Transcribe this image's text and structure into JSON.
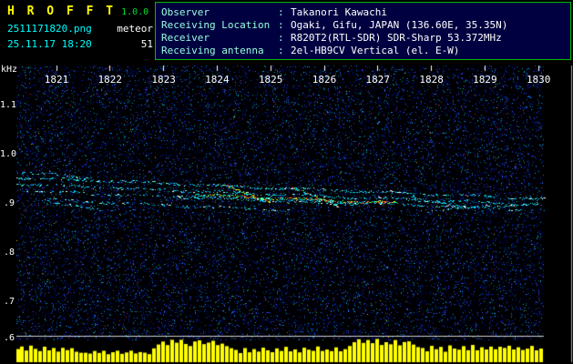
{
  "header": {
    "app_title": "H R O F F T",
    "app_version": "1.0.0",
    "filename": "2511171820.png",
    "mode": "meteor",
    "timestamp": "25.11.17 18:20",
    "count": "51"
  },
  "info": {
    "colon": ":",
    "rows": [
      {
        "label": "Observer",
        "value": "Takanori Kawachi"
      },
      {
        "label": "Receiving Location",
        "value": "Ogaki, Gifu, JAPAN (136.60E, 35.35N)"
      },
      {
        "label": "Receiver",
        "value": "R820T2(RTL-SDR) SDR-Sharp 53.372MHz"
      },
      {
        "label": "Receiving antenna",
        "value": "2el-HB9CV Vertical (el. E-W)"
      }
    ]
  },
  "colors": {
    "bg": "#000000",
    "panel-bg": "#000041",
    "panel-border": "#00bb00",
    "title-yellow": "#ffff00",
    "version-green": "#00dd33",
    "cyan": "#00ffff",
    "white": "#ffffff",
    "info-label": "#99ffdd",
    "axis-text": "#ffffff",
    "separator": "#cccccc"
  },
  "chart_data": {
    "type": "heatmap",
    "subtype": "radio-meteor-spectrogram",
    "x_axis": {
      "ticks": [
        "1821",
        "1822",
        "1823",
        "1824",
        "1825",
        "1826",
        "1827",
        "1828",
        "1829",
        "1830"
      ]
    },
    "y_axis": {
      "unit": "kHz",
      "tick_values": [
        1.1,
        1.0,
        0.9,
        0.8,
        0.7,
        0.6
      ],
      "tick_labels": [
        "1.1",
        "1.0",
        ".9",
        ".8",
        ".7",
        ".6"
      ],
      "range_khz": [
        0.62,
        1.18
      ]
    },
    "traces": [
      {
        "x0": 0.0,
        "f0": 0.952,
        "x1": 1.0,
        "f1": 0.908,
        "density": 0.5,
        "style": "cyan"
      },
      {
        "x0": 0.0,
        "f0": 0.938,
        "x1": 1.0,
        "f1": 0.896,
        "density": 0.45,
        "style": "cyan"
      },
      {
        "x0": 0.02,
        "f0": 0.924,
        "x1": 0.65,
        "f1": 0.897,
        "density": 0.4,
        "style": "cyan"
      },
      {
        "x0": 0.05,
        "f0": 0.906,
        "x1": 0.52,
        "f1": 0.884,
        "density": 0.32,
        "style": "cyan"
      },
      {
        "x0": 0.3,
        "f0": 0.916,
        "x1": 1.0,
        "f1": 0.884,
        "density": 0.45,
        "style": "cyan"
      },
      {
        "x0": 0.34,
        "f0": 0.917,
        "x1": 0.72,
        "f1": 0.899,
        "density": 0.75,
        "style": "hot"
      },
      {
        "x0": 0.4,
        "f0": 0.932,
        "x1": 0.48,
        "f1": 0.904,
        "density": 0.85,
        "style": "hot"
      },
      {
        "x0": 0.52,
        "f0": 0.93,
        "x1": 0.61,
        "f1": 0.893,
        "density": 0.8,
        "style": "mix"
      },
      {
        "x0": 0.75,
        "f0": 0.913,
        "x1": 0.87,
        "f1": 0.887,
        "density": 0.65,
        "style": "cyan"
      },
      {
        "x0": 0.78,
        "f0": 0.884,
        "x1": 0.99,
        "f1": 0.899,
        "density": 0.35,
        "style": "cyan"
      },
      {
        "x0": 0.01,
        "f0": 0.964,
        "x1": 0.14,
        "f1": 0.95,
        "density": 0.45,
        "style": "cyan"
      },
      {
        "x0": 0.06,
        "f0": 0.898,
        "x1": 0.16,
        "f1": 0.888,
        "density": 0.5,
        "style": "cyan"
      }
    ],
    "activity_bars": {
      "color": "#ffff00",
      "values": [
        0.5,
        0.62,
        0.45,
        0.7,
        0.55,
        0.4,
        0.65,
        0.5,
        0.58,
        0.42,
        0.6,
        0.48,
        0.55,
        0.4,
        0.3,
        0.38,
        0.28,
        0.45,
        0.33,
        0.4,
        0.3,
        0.35,
        0.42,
        0.3,
        0.38,
        0.45,
        0.32,
        0.4,
        0.35,
        0.3,
        0.55,
        0.75,
        0.9,
        0.7,
        1.0,
        0.85,
        0.95,
        0.8,
        0.7,
        0.9,
        1.0,
        0.75,
        0.85,
        0.95,
        0.7,
        0.8,
        0.65,
        0.6,
        0.45,
        0.35,
        0.55,
        0.4,
        0.5,
        0.38,
        0.6,
        0.42,
        0.35,
        0.55,
        0.45,
        0.65,
        0.4,
        0.5,
        0.35,
        0.58,
        0.45,
        0.4,
        0.62,
        0.38,
        0.5,
        0.44,
        0.56,
        0.4,
        0.48,
        0.7,
        0.9,
        1.0,
        0.8,
        0.95,
        0.85,
        1.0,
        0.75,
        0.9,
        0.8,
        0.95,
        0.7,
        0.85,
        0.9,
        0.75,
        0.65,
        0.55,
        0.45,
        0.65,
        0.5,
        0.6,
        0.42,
        0.7,
        0.55,
        0.48,
        0.62,
        0.5,
        0.68,
        0.45,
        0.58,
        0.52,
        0.65,
        0.48,
        0.6,
        0.55,
        0.7,
        0.5,
        0.62,
        0.45,
        0.58,
        0.65,
        0.5,
        0.55
      ]
    },
    "noise_colors": [
      "#000044",
      "#000066",
      "#001488",
      "#0022aa",
      "#2233cc",
      "#4455ee",
      "#006699",
      "#00aacc"
    ],
    "accent_colors": {
      "hot": [
        "#ffff00",
        "#ff8800",
        "#ff3344",
        "#33ff66",
        "#00ffff"
      ],
      "cyan_trace": [
        "#00e0ff",
        "#009fdf",
        "#66ffcc",
        "#ffffff"
      ]
    }
  }
}
